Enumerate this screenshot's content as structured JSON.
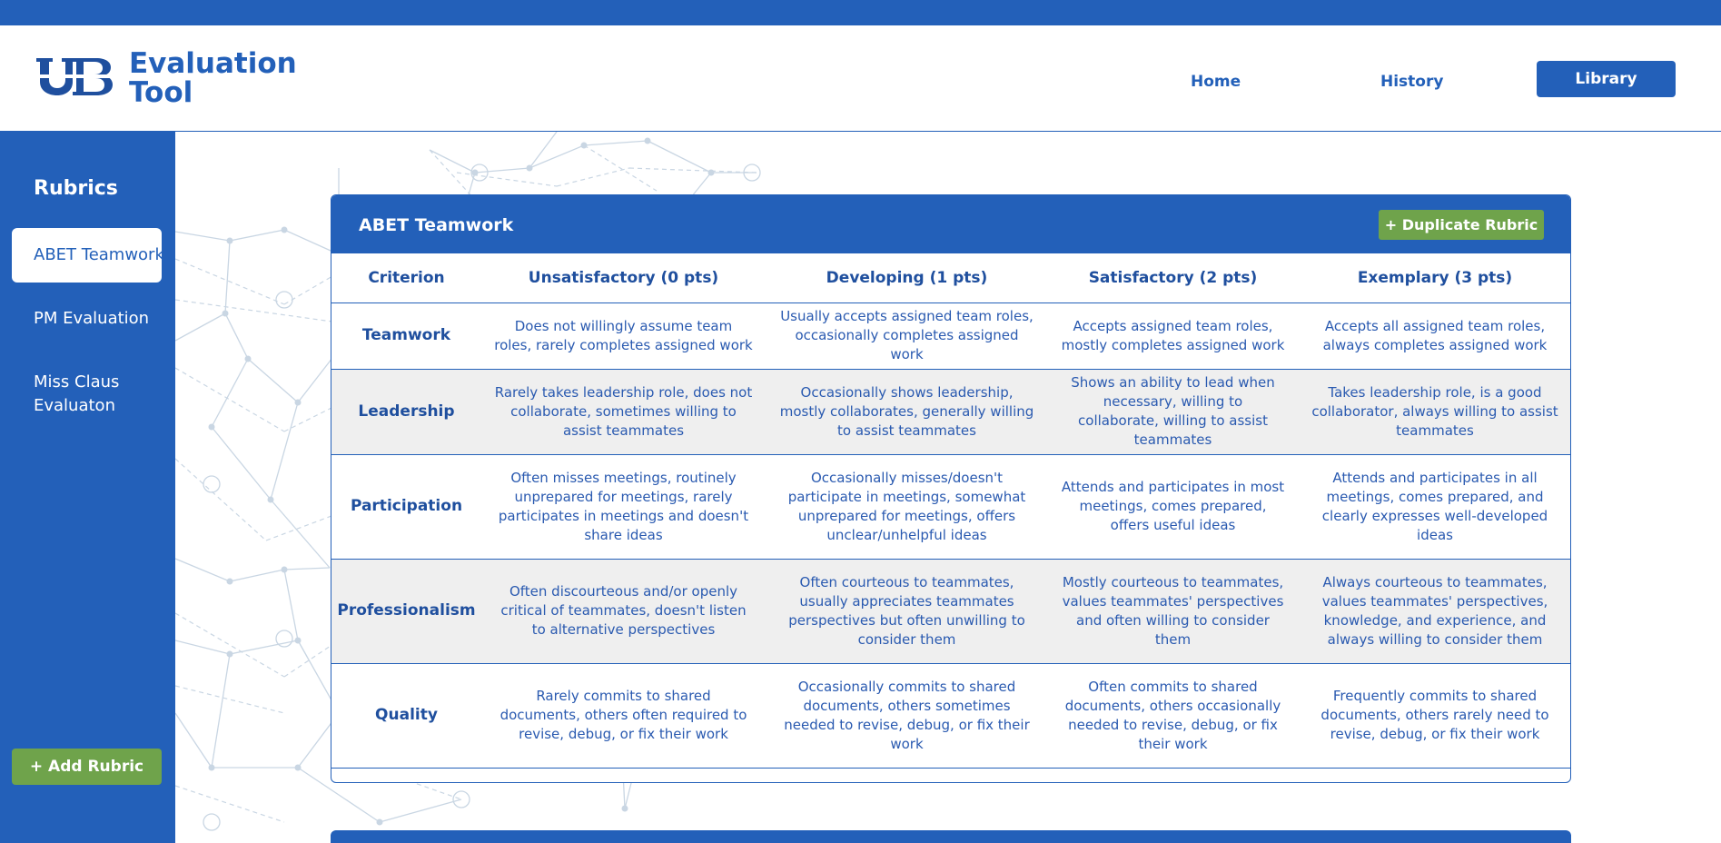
{
  "header": {
    "logo_icon": "ub-logo",
    "app_title_line1": "Evaluation",
    "app_title_line2": "Tool",
    "nav": {
      "home": "Home",
      "history": "History",
      "library": "Library"
    },
    "brand_color": "#2360b9"
  },
  "sidebar": {
    "title": "Rubrics",
    "items": [
      {
        "label": "ABET Teamwork",
        "active": true
      },
      {
        "label": "PM Evaluation",
        "active": false
      },
      {
        "label": "Miss Claus Evaluaton",
        "active": false
      }
    ],
    "add_button": "+ Add Rubric",
    "accent_green": "#6fa34b"
  },
  "rubric": {
    "title": "ABET Teamwork",
    "duplicate_button": "+ Duplicate Rubric",
    "columns": [
      "Criterion",
      "Unsatisfactory (0 pts)",
      "Developing (1 pts)",
      "Satisfactory (2 pts)",
      "Exemplary (3 pts)"
    ],
    "rows": [
      {
        "criterion": "Teamwork",
        "cells": [
          "Does not willingly assume team roles, rarely completes assigned work",
          "Usually accepts assigned team roles, occasionally completes assigned work",
          "Accepts assigned team roles, mostly completes assigned work",
          "Accepts all assigned team roles, always completes assigned work"
        ]
      },
      {
        "criterion": "Leadership",
        "cells": [
          "Rarely takes leadership role, does not collaborate, sometimes willing to assist teammates",
          "Occasionally shows leadership, mostly collaborates, generally willing to assist teammates",
          "Shows an ability to lead when necessary, willing to collaborate, willing to assist teammates",
          "Takes leadership role, is a good collaborator, always willing to assist teammates"
        ]
      },
      {
        "criterion": "Participation",
        "cells": [
          "Often misses meetings, routinely unprepared for meetings, rarely participates in meetings and doesn't share ideas",
          "Occasionally misses/doesn't participate in meetings, somewhat unprepared for meetings, offers unclear/unhelpful ideas",
          "Attends and participates in most meetings, comes prepared, offers useful ideas",
          "Attends and participates in all meetings, comes prepared, and clearly expresses well-developed ideas"
        ]
      },
      {
        "criterion": "Professionalism",
        "cells": [
          "Often discourteous and/or openly critical of teammates, doesn't listen to alternative perspectives",
          "Often courteous to teammates, usually appreciates teammates perspectives but often unwilling to consider them",
          "Mostly courteous to teammates, values teammates' perspectives and often willing to consider them",
          "Always courteous to teammates, values teammates' perspectives, knowledge, and experience, and always willing to consider them"
        ]
      },
      {
        "criterion": "Quality",
        "cells": [
          "Rarely commits to shared documents, others often required to revise, debug, or fix their work",
          "Occasionally commits to shared documents, others sometimes needed to revise, debug, or fix their work",
          "Often commits to shared documents, others occasionally needed to revise, debug, or fix their work",
          "Frequently commits to shared documents, others rarely need to revise, debug, or fix their work"
        ]
      }
    ]
  }
}
